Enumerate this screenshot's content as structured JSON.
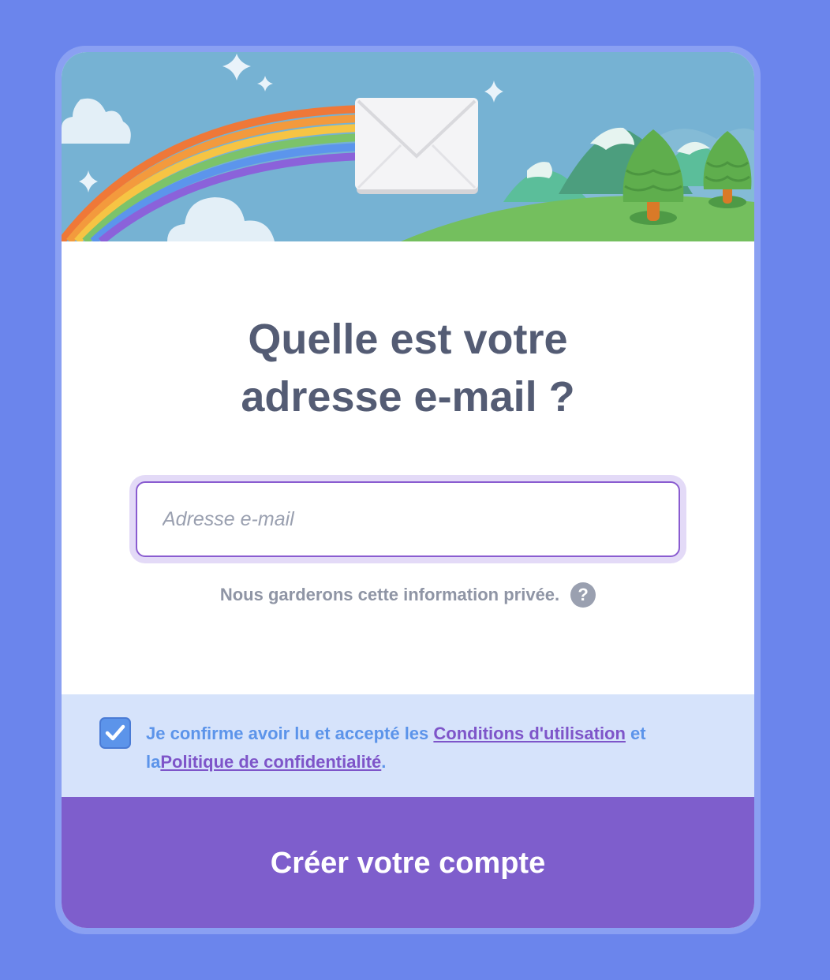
{
  "colors": {
    "page_background": "#6B85EC",
    "card_background": "#ffffff",
    "title_text": "#545C74",
    "input_border": "#8A5CD0",
    "terms_panel": "#D6E3FB",
    "terms_text": "#5C94EA",
    "link": "#7E55C9",
    "submit_button": "#7E5ECC"
  },
  "banner": {
    "icons": [
      "rainbow-icon",
      "envelope-icon",
      "cloud-icon",
      "star-icon",
      "mountain-icon",
      "tree-icon"
    ]
  },
  "form": {
    "title_line1": "Quelle est votre",
    "title_line2": "adresse e-mail ?",
    "email_placeholder": "Adresse e-mail",
    "email_value": "",
    "privacy_note": "Nous garderons cette information privée.",
    "help_icon": "?"
  },
  "terms": {
    "checked": true,
    "prefix": "Je confirme avoir lu et accepté les ",
    "terms_link": "Conditions d'utilisation",
    "middle": " et la",
    "privacy_link": "Politique de confidentialité",
    "suffix": "."
  },
  "submit": {
    "label": "Créer votre compte"
  }
}
